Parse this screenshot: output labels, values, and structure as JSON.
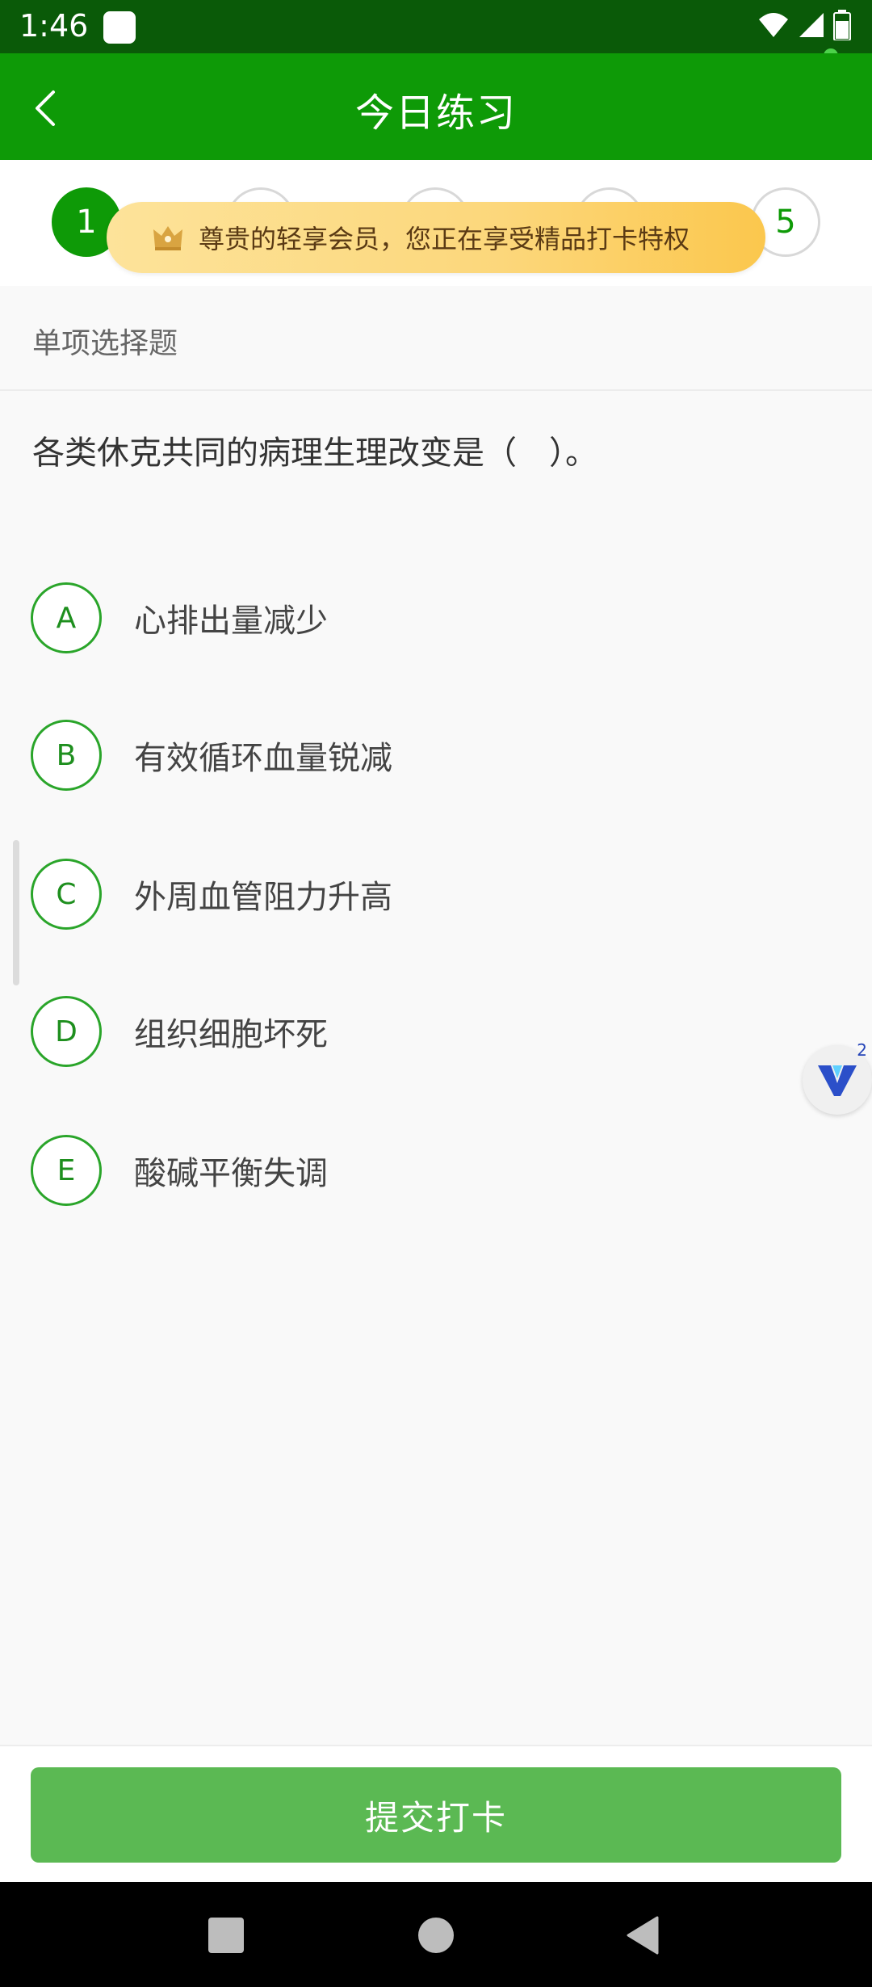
{
  "status_bar": {
    "time": "1:46"
  },
  "app_bar": {
    "title": "今日练习",
    "back_icon": "chevron-left-icon"
  },
  "progress": {
    "steps": [
      "1",
      "",
      "",
      "",
      "5"
    ],
    "active_step": "1",
    "member_banner": "尊贵的轻享会员，您正在享受精品打卡特权",
    "member_icon": "crown-icon"
  },
  "section_label": "单项选择题",
  "question": "各类休克共同的病理生理改变是（　）。",
  "options": [
    {
      "letter": "A",
      "text": "心排出量减少"
    },
    {
      "letter": "B",
      "text": "有效循环血量锐减"
    },
    {
      "letter": "C",
      "text": "外周血管阻力升高"
    },
    {
      "letter": "D",
      "text": "组织细胞坏死"
    },
    {
      "letter": "E",
      "text": "酸碱平衡失调"
    }
  ],
  "floating_badge": {
    "icon": "v-logo-icon",
    "count": "2"
  },
  "submit": {
    "label": "提交打卡"
  },
  "colors": {
    "primary": "#0e9a07",
    "status_bar": "#0a5a08",
    "submit": "#5bb953",
    "option_border": "#2aa52a"
  }
}
